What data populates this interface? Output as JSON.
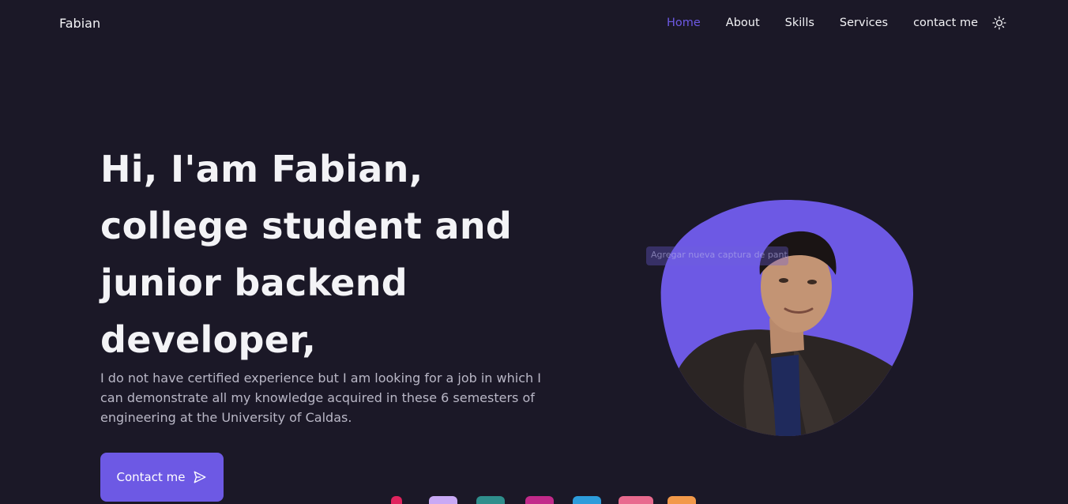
{
  "nav": {
    "logo": "Fabian",
    "links": [
      "Home",
      "About",
      "Skills",
      "Services",
      "contact me"
    ],
    "active": "Home",
    "theme_icon": "sun-icon"
  },
  "hero": {
    "title_lines": [
      "Hi, I'am Fabian,",
      "college student and",
      "junior backend",
      "developer,"
    ],
    "description": "I do not have certified experience but I am looking for a job in which I can demonstrate all my knowledge acquired in these 6 semesters of engineering at the University of Caldas.",
    "cta_label": "Contact me",
    "cta_icon": "send-icon",
    "image_overlay_text": "Agregar nueva captura de pantalla"
  },
  "colors": {
    "background": "#1b1827",
    "accent": "#6d59e4",
    "text": "#f3f3f6",
    "muted_text": "#b9b7c6"
  }
}
